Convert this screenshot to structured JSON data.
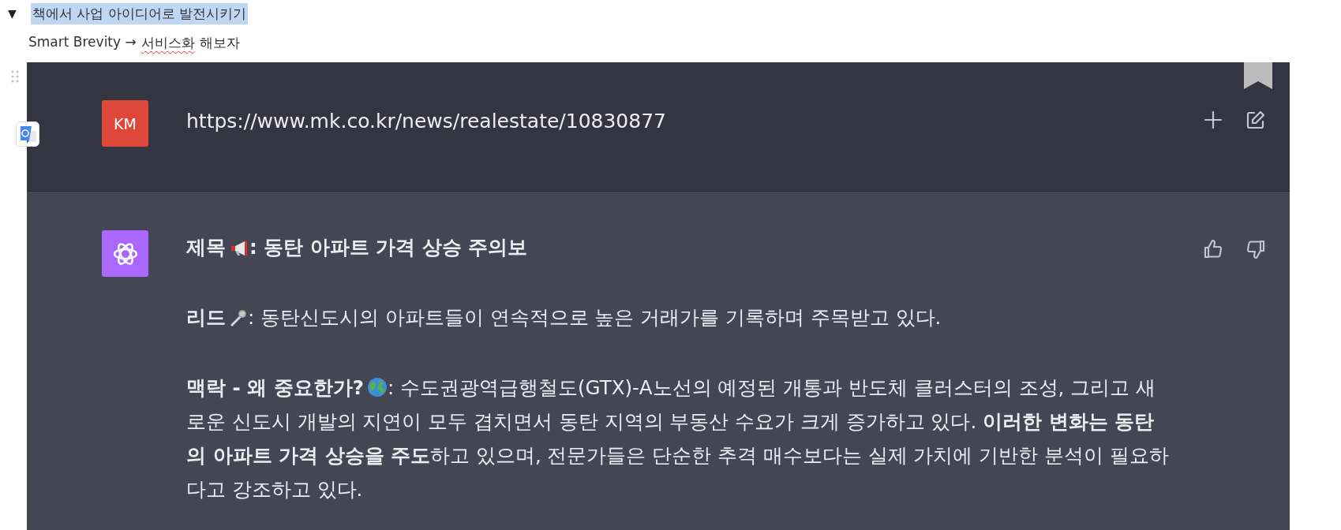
{
  "toggle": {
    "symbol": "▼",
    "expanded": true
  },
  "heading": {
    "text": "책에서 사업 아이디어로 발전시키기",
    "selected": true
  },
  "note": {
    "parts": [
      {
        "text": "Smart Brevity →",
        "misspelled": false
      },
      {
        "text": "서비스화",
        "misspelled": true
      },
      {
        "text": "해보자",
        "misspelled": false
      }
    ]
  },
  "prompt": {
    "avatar": "KM",
    "text": "https://www.mk.co.kr/news/realestate/10830877"
  },
  "response": {
    "paragraphs": [
      {
        "kind": "title",
        "label": "제목",
        "text": ": 동탄 아파트 가격 상승 주의보"
      },
      {
        "kind": "lead",
        "label": "리드",
        "text": ": 동탄신도시의 아파트들이 연속적으로 높은 거래가를 기록하며 주목받고 있다."
      },
      {
        "kind": "context",
        "label": "맥락 - 왜 중요한가?",
        "text": ": 수도권광역급행철도(GTX)-A노선의 예정된 개통과 반도체 클러스터의 조성, 그리고 새로운 신도시 개발의 지연이 모두 겹치면서 동탄 지역의 부동산 수요가 크게 증가하고 있다. **이러한 변화는 동탄의 아파트 가격 상승을 주도**하고 있으며, 전문가들은 단순한 추격 매수보다는 실제 가치에 기반한 분석이 필요하다고 강조하고 있다."
      }
    ]
  }
}
